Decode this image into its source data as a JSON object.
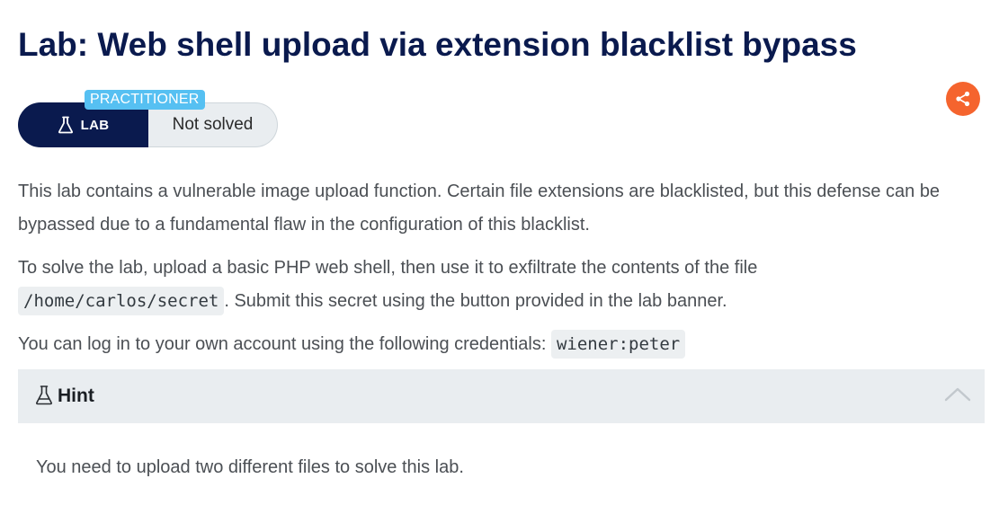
{
  "header": {
    "title": "Lab: Web shell upload via extension blacklist bypass"
  },
  "badge": {
    "level": "PRACTITIONER",
    "lab_label": "LAB",
    "status": "Not solved",
    "lab_icon": "flask-icon"
  },
  "share": {
    "icon": "share-icon",
    "color": "#f5642e"
  },
  "description": {
    "p1": "This lab contains a vulnerable image upload function. Certain file extensions are blacklisted, but this defense can be bypassed due to a fundamental flaw in the configuration of this blacklist.",
    "p2_before": "To solve the lab, upload a basic PHP web shell, then use it to exfiltrate the contents of the file ",
    "p2_code": "/home/carlos/secret",
    "p2_after": ". Submit this secret using the button provided in the lab banner.",
    "p3_before": "You can log in to your own account using the following credentials: ",
    "p3_code": "wiener:peter"
  },
  "hint": {
    "label": "Hint",
    "icon": "flask-icon",
    "toggle_icon": "chevron-up-icon",
    "body": "You need to upload two different files to solve this lab."
  },
  "colors": {
    "title": "#0a1a4e",
    "badge_dark": "#0a1a4e",
    "level_tag": "#56c0f2",
    "panel_bg": "#e9edf0"
  }
}
